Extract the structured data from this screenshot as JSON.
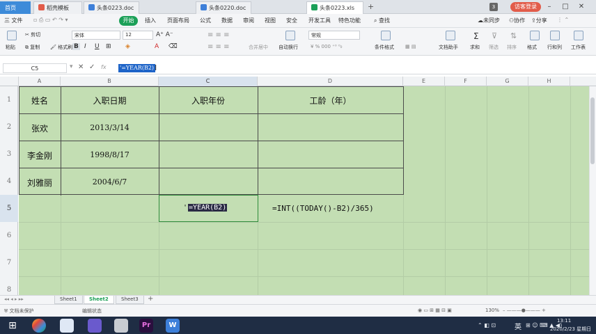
{
  "titlebar": {
    "tabs": [
      {
        "label": "首页"
      },
      {
        "label": "稻壳模板"
      },
      {
        "label": "头条0223.doc"
      },
      {
        "label": "头条0220.doc"
      },
      {
        "label": "头条0223.xls"
      }
    ],
    "add_tab": "+",
    "tab_count": "3",
    "visitor_login": "访客登录"
  },
  "menubar": {
    "file": "三 文件",
    "items": [
      "开始",
      "插入",
      "页面布局",
      "公式",
      "数据",
      "审阅",
      "视图",
      "安全",
      "开发工具",
      "特色功能"
    ],
    "search": "查找",
    "sync": "未同步",
    "collab": "协作",
    "share": "分享"
  },
  "ribbon": {
    "paste": "粘贴",
    "cut": "剪切",
    "copy": "复制",
    "format_painter": "格式刷",
    "font_name": "宋体",
    "font_size": "12",
    "wrap": "自动换行",
    "number_format": "常规",
    "merge_center": "合并居中",
    "conditional_format": "条件格式",
    "doc_helper": "文档助手",
    "sum": "求和",
    "filter": "筛选",
    "sort": "排序",
    "format": "格式",
    "row_col": "行和列",
    "worksheet": "工作表"
  },
  "formulabar": {
    "name_box": "C5",
    "fx": "fx",
    "content": "'=YEAR(B2)"
  },
  "columns": [
    "A",
    "B",
    "C",
    "D",
    "E",
    "F",
    "G",
    "H"
  ],
  "rows": [
    "1",
    "2",
    "3",
    "4",
    "5",
    "6",
    "7",
    "8"
  ],
  "table": {
    "headers": [
      "姓名",
      "入职日期",
      "入职年份",
      "工龄（年）"
    ],
    "rows": [
      [
        "张欢",
        "2013/3/14"
      ],
      [
        "李金刚",
        "1998/8/17"
      ],
      [
        "刘雅丽",
        "2004/6/7"
      ]
    ]
  },
  "cells": {
    "c5_quote": "'",
    "c5_formula": "=YEAR(B2)",
    "d5": "=INT((TODAY()-B2)/365)"
  },
  "sheets": [
    "Sheet1",
    "Sheet2",
    "Sheet3"
  ],
  "active_sheet": "Sheet2",
  "statusbar": {
    "doc_unprotected": "文档未保护",
    "edit_state": "编辑状态",
    "zoom": "130%"
  },
  "taskbar": {
    "ime": "英",
    "time": "13:11",
    "date": "2020/2/23 星期日"
  }
}
